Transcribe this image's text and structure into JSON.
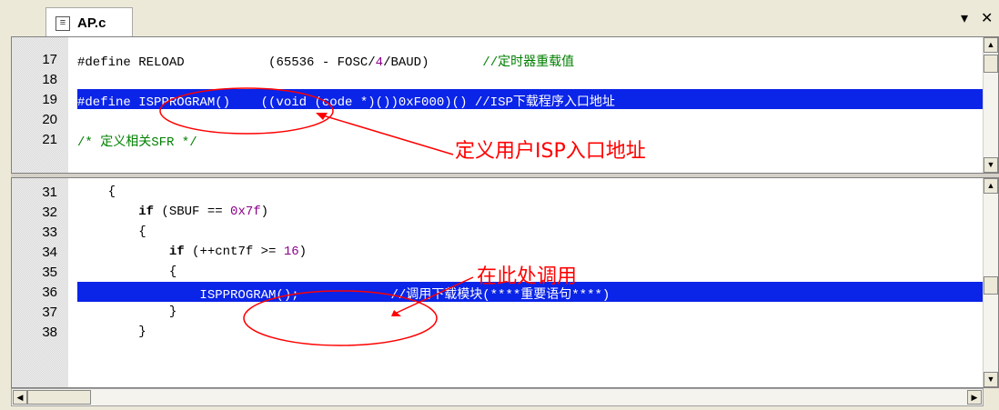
{
  "tab": {
    "label": "AP.c",
    "dropdown_icon": "chevron-down-icon",
    "close_icon": "close-icon",
    "dropdown_glyph": "▾",
    "close_glyph": "✕"
  },
  "top_pane": {
    "lines": [
      {
        "num": "17",
        "parts": [
          {
            "t": "#define RELOAD           ",
            "c": "str"
          },
          {
            "t": "(65536 - FOSC/",
            "c": "str"
          },
          {
            "t": "4",
            "c": "num"
          },
          {
            "t": "/BAUD)",
            "c": "str"
          },
          {
            "t": "       //定时器重载值",
            "c": "cmt"
          }
        ]
      },
      {
        "num": "18",
        "parts": []
      },
      {
        "num": "19",
        "selected": true,
        "parts": [
          {
            "t": "#define ISPPROGRAM()    ((void (code *)())0xF000)() //ISP下载程序入口地址",
            "c": "str"
          }
        ]
      },
      {
        "num": "20",
        "parts": []
      },
      {
        "num": "21",
        "parts": [
          {
            "t": "/* 定义相关SFR */",
            "c": "cmt"
          }
        ]
      }
    ]
  },
  "bottom_pane": {
    "lines": [
      {
        "num": "31",
        "parts": [
          {
            "t": "    {",
            "c": "str"
          }
        ]
      },
      {
        "num": "32",
        "parts": [
          {
            "t": "        ",
            "c": "str"
          },
          {
            "t": "if",
            "c": "kw"
          },
          {
            "t": " (SBUF == ",
            "c": "str"
          },
          {
            "t": "0x7f",
            "c": "num"
          },
          {
            "t": ")",
            "c": "str"
          }
        ]
      },
      {
        "num": "33",
        "parts": [
          {
            "t": "        {",
            "c": "str"
          }
        ]
      },
      {
        "num": "34",
        "parts": [
          {
            "t": "            ",
            "c": "str"
          },
          {
            "t": "if",
            "c": "kw"
          },
          {
            "t": " (++cnt7f >= ",
            "c": "str"
          },
          {
            "t": "16",
            "c": "num"
          },
          {
            "t": ")",
            "c": "str"
          }
        ]
      },
      {
        "num": "35",
        "parts": [
          {
            "t": "            {",
            "c": "str"
          }
        ]
      },
      {
        "num": "36",
        "selected": true,
        "parts": [
          {
            "t": "                ISPPROGRAM();            //调用下载模块(****重要语句****)",
            "c": "str"
          }
        ]
      },
      {
        "num": "37",
        "parts": [
          {
            "t": "            }",
            "c": "str"
          }
        ]
      },
      {
        "num": "38",
        "parts": [
          {
            "t": "        }",
            "c": "str"
          }
        ]
      }
    ]
  },
  "annotations": {
    "top_label": "定义用户ISP入口地址",
    "bottom_label": "在此处调用"
  },
  "colors": {
    "selection": "#0a24e8",
    "annotation": "#ff0000",
    "comment": "#008000",
    "number": "#8b008b"
  }
}
